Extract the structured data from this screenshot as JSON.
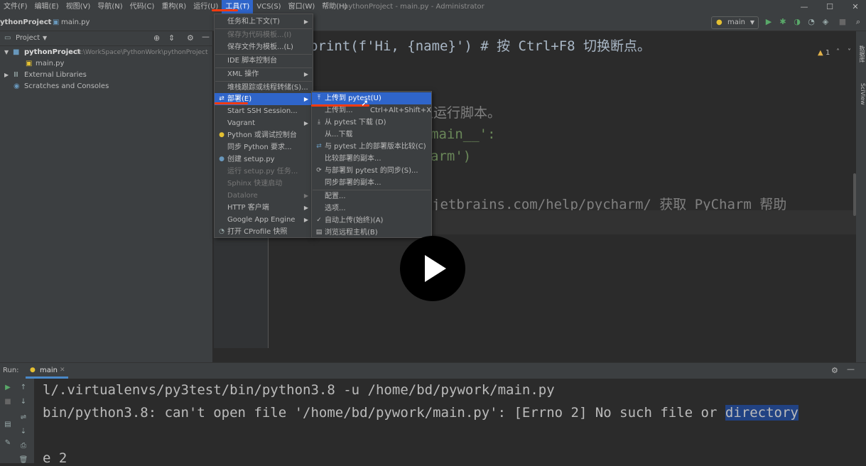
{
  "menubar": {
    "items": [
      "文件(F)",
      "编辑(E)",
      "视图(V)",
      "导航(N)",
      "代码(C)",
      "重构(R)",
      "运行(U)",
      "工具(T)",
      "VCS(S)",
      "窗口(W)",
      "帮助(H)"
    ],
    "title": "pythonProject - main.py - Administrator"
  },
  "navbar": {
    "project": "ythonProject",
    "file": "main.py",
    "run_config": "main"
  },
  "project_panel": {
    "header": "Project",
    "root_name": "pythonProject",
    "root_path": "D:\\WorkSpace\\PythonWork\\pythonProject",
    "file": "main.py",
    "external": "External Libraries",
    "scratches": "Scratches and Consoles"
  },
  "editor": {
    "lines": [
      "print(f'Hi, {name}')  # 按 Ctrl+F8 切换断点。",
      "以运行脚本。",
      "main__':",
      "arm')",
      "jetbrains.com/help/pycharm/ 获取 PyCharm 帮助"
    ],
    "warning_count": "1"
  },
  "right_tabs": [
    "数据库",
    "SciView"
  ],
  "tools_menu": {
    "items": [
      {
        "label": "任务和上下文(T)",
        "arrow": true,
        "disabled": false
      },
      {
        "label": "保存为代码模板...(I)",
        "arrow": false,
        "disabled": true
      },
      {
        "label": "保存文件为模板...(L)",
        "arrow": false,
        "disabled": false
      },
      {
        "label": "IDE 脚本控制台",
        "arrow": false,
        "disabled": false
      },
      {
        "label": "XML 操作",
        "arrow": true,
        "disabled": false
      },
      {
        "label": "堆栈跟踪或线程转储(S)...",
        "arrow": false,
        "disabled": false
      },
      {
        "label": "部署(E)",
        "arrow": true,
        "disabled": false
      },
      {
        "label": "Start SSH Session...",
        "arrow": false,
        "disabled": false
      },
      {
        "label": "Vagrant",
        "arrow": true,
        "disabled": false
      },
      {
        "label": "Python 或调试控制台",
        "arrow": false,
        "disabled": false
      },
      {
        "label": "同步 Python 要求...",
        "arrow": false,
        "disabled": false
      },
      {
        "label": "创建 setup.py",
        "arrow": false,
        "disabled": false
      },
      {
        "label": "运行 setup.py 任务...",
        "arrow": false,
        "disabled": true
      },
      {
        "label": "Sphinx 快速启动",
        "arrow": false,
        "disabled": true
      },
      {
        "label": "Datalore",
        "arrow": true,
        "disabled": true
      },
      {
        "label": "HTTP 客户端",
        "arrow": true,
        "disabled": false
      },
      {
        "label": "Google App Engine",
        "arrow": true,
        "disabled": false
      },
      {
        "label": "打开 CProfile 快照",
        "arrow": false,
        "disabled": false
      }
    ]
  },
  "deploy_menu": {
    "items": [
      {
        "label": "上传到 pytest(U)",
        "shortcut": ""
      },
      {
        "label": "上传到...",
        "shortcut": "Ctrl+Alt+Shift+X"
      },
      {
        "label": "从 pytest 下载 (D)",
        "shortcut": ""
      },
      {
        "label": "从...下载",
        "shortcut": ""
      },
      {
        "label": "与 pytest 上的部署版本比较(C)",
        "shortcut": ""
      },
      {
        "label": "比较部署的副本...",
        "shortcut": ""
      },
      {
        "label": "与部署到 pytest 的同步(S)...",
        "shortcut": ""
      },
      {
        "label": "同步部署的副本...",
        "shortcut": ""
      },
      {
        "label": "配置...",
        "shortcut": ""
      },
      {
        "label": "选项...",
        "shortcut": ""
      },
      {
        "label": "自动上传(始终)(A)",
        "shortcut": ""
      },
      {
        "label": "浏览远程主机(B)",
        "shortcut": ""
      }
    ]
  },
  "run_panel": {
    "label": "Run:",
    "tab": "main",
    "line1": "l/.virtualenvs/py3test/bin/python3.8 -u /home/bd/pywork/main.py",
    "line2_a": "bin/python3.8: can't open file '/home/bd/pywork/main.py': [Errno 2] No such file or ",
    "line2_sel": "directory",
    "line3": "e 2"
  },
  "colors": {
    "accent": "#2f65ca",
    "annotation": "#ff3b10",
    "bg": "#2b2b2b",
    "panel": "#3c3f41"
  }
}
